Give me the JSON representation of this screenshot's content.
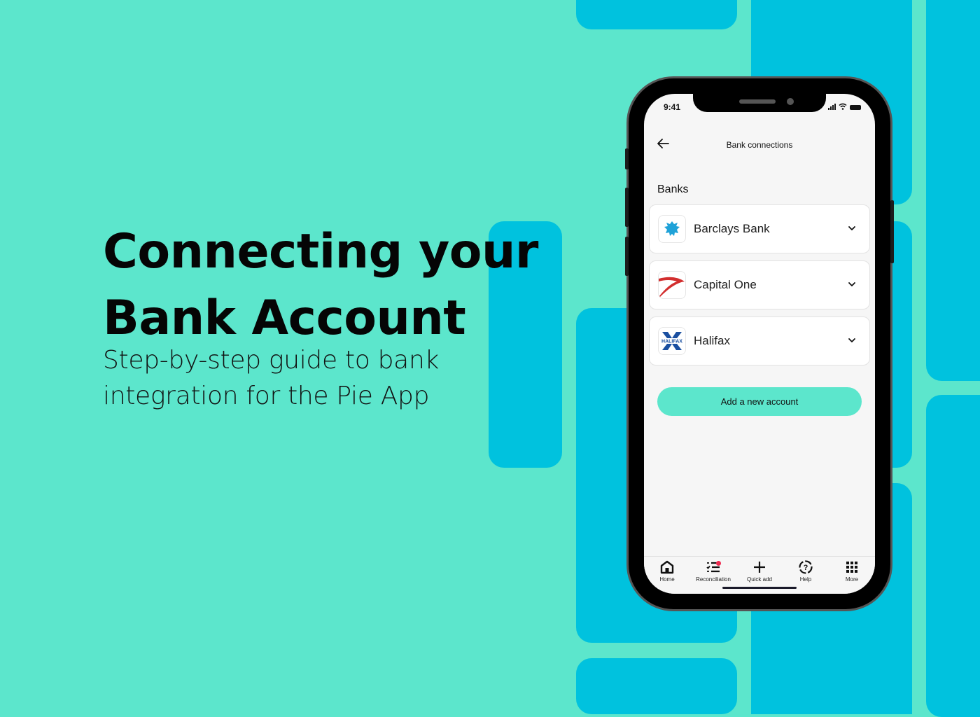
{
  "hero": {
    "title_line1": "Connecting your",
    "title_line2": "Bank Account",
    "subtitle_line1": "Step-by-step guide to bank",
    "subtitle_line2": "integration for the Pie App"
  },
  "colors": {
    "background": "#5ce6cc",
    "accent_blocks": "#00c2de",
    "primary_button": "#5ce6cc",
    "notification_badge": "#ee2a4f"
  },
  "phone": {
    "status_bar": {
      "time": "9:41",
      "icons": [
        "signal-icon",
        "wifi-icon",
        "battery-icon"
      ]
    },
    "header": {
      "back_icon": "arrow-left-icon",
      "title": "Bank connections"
    },
    "section_label": "Banks",
    "banks": [
      {
        "name": "Barclays Bank",
        "logo": "barclays-eagle-logo",
        "expand_icon": "chevron-down-icon"
      },
      {
        "name": "Capital One",
        "logo": "capital-one-swoosh-logo",
        "expand_icon": "chevron-down-icon"
      },
      {
        "name": "Halifax",
        "logo": "halifax-x-logo",
        "logo_text": "HALIFAX",
        "expand_icon": "chevron-down-icon"
      }
    ],
    "add_button": "Add a new account",
    "tabs": [
      {
        "label": "Home",
        "icon": "home-icon"
      },
      {
        "label": "Reconciliation",
        "icon": "checklist-icon",
        "has_badge": true
      },
      {
        "label": "Quick add",
        "icon": "plus-icon"
      },
      {
        "label": "Help",
        "icon": "help-icon"
      },
      {
        "label": "More",
        "icon": "grid-icon"
      }
    ]
  }
}
